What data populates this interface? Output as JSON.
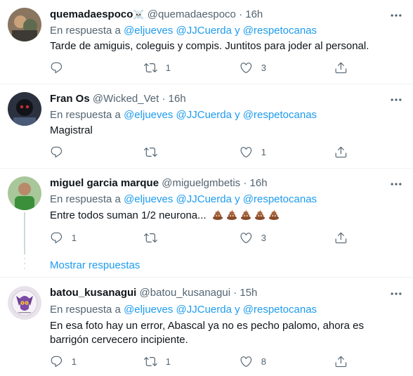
{
  "tweets": [
    {
      "name": "quemadaespoco",
      "name_emoji": "☠️",
      "handle": "@quemadaespoco",
      "time": "16h",
      "reply_prefix": "En respuesta a",
      "mentions": "@eljueves @JJCuerda y @respetocanas",
      "text": "Tarde de amiguis, coleguis y compis. Juntitos para joder al personal.",
      "replies": "",
      "retweets": "1",
      "likes": "3"
    },
    {
      "name": "Fran Os",
      "handle": "@Wicked_Vet",
      "time": "16h",
      "reply_prefix": "En respuesta a",
      "mentions": "@eljueves @JJCuerda y @respetocanas",
      "text": "Magistral",
      "replies": "",
      "retweets": "",
      "likes": "1"
    },
    {
      "name": "miguel garcia marque",
      "handle": "@miguelgmbetis",
      "time": "16h",
      "reply_prefix": "En respuesta a",
      "mentions": "@eljueves @JJCuerda y @respetocanas",
      "text": "Entre todos suman 1/2 neurona...",
      "text_emoji": "💩💩💩💩💩",
      "replies": "1",
      "retweets": "",
      "likes": "3"
    },
    {
      "name": "batou_kusanagui",
      "handle": "@batou_kusanagui",
      "time": "15h",
      "reply_prefix": "En respuesta a",
      "mentions": "@eljueves @JJCuerda y @respetocanas",
      "text": "En esa foto hay un error, Abascal ya no es pecho palomo, ahora es barrigón cervecero incipiente.",
      "replies": "1",
      "retweets": "1",
      "likes": "8"
    }
  ],
  "show_replies": "Mostrar respuestas",
  "separator": "·",
  "icons": {
    "reply": "reply-icon",
    "retweet": "retweet-icon",
    "like": "heart-icon",
    "share": "share-icon",
    "more": "more-icon"
  },
  "colors": {
    "link": "#1d9bf0",
    "muted": "#536471"
  }
}
